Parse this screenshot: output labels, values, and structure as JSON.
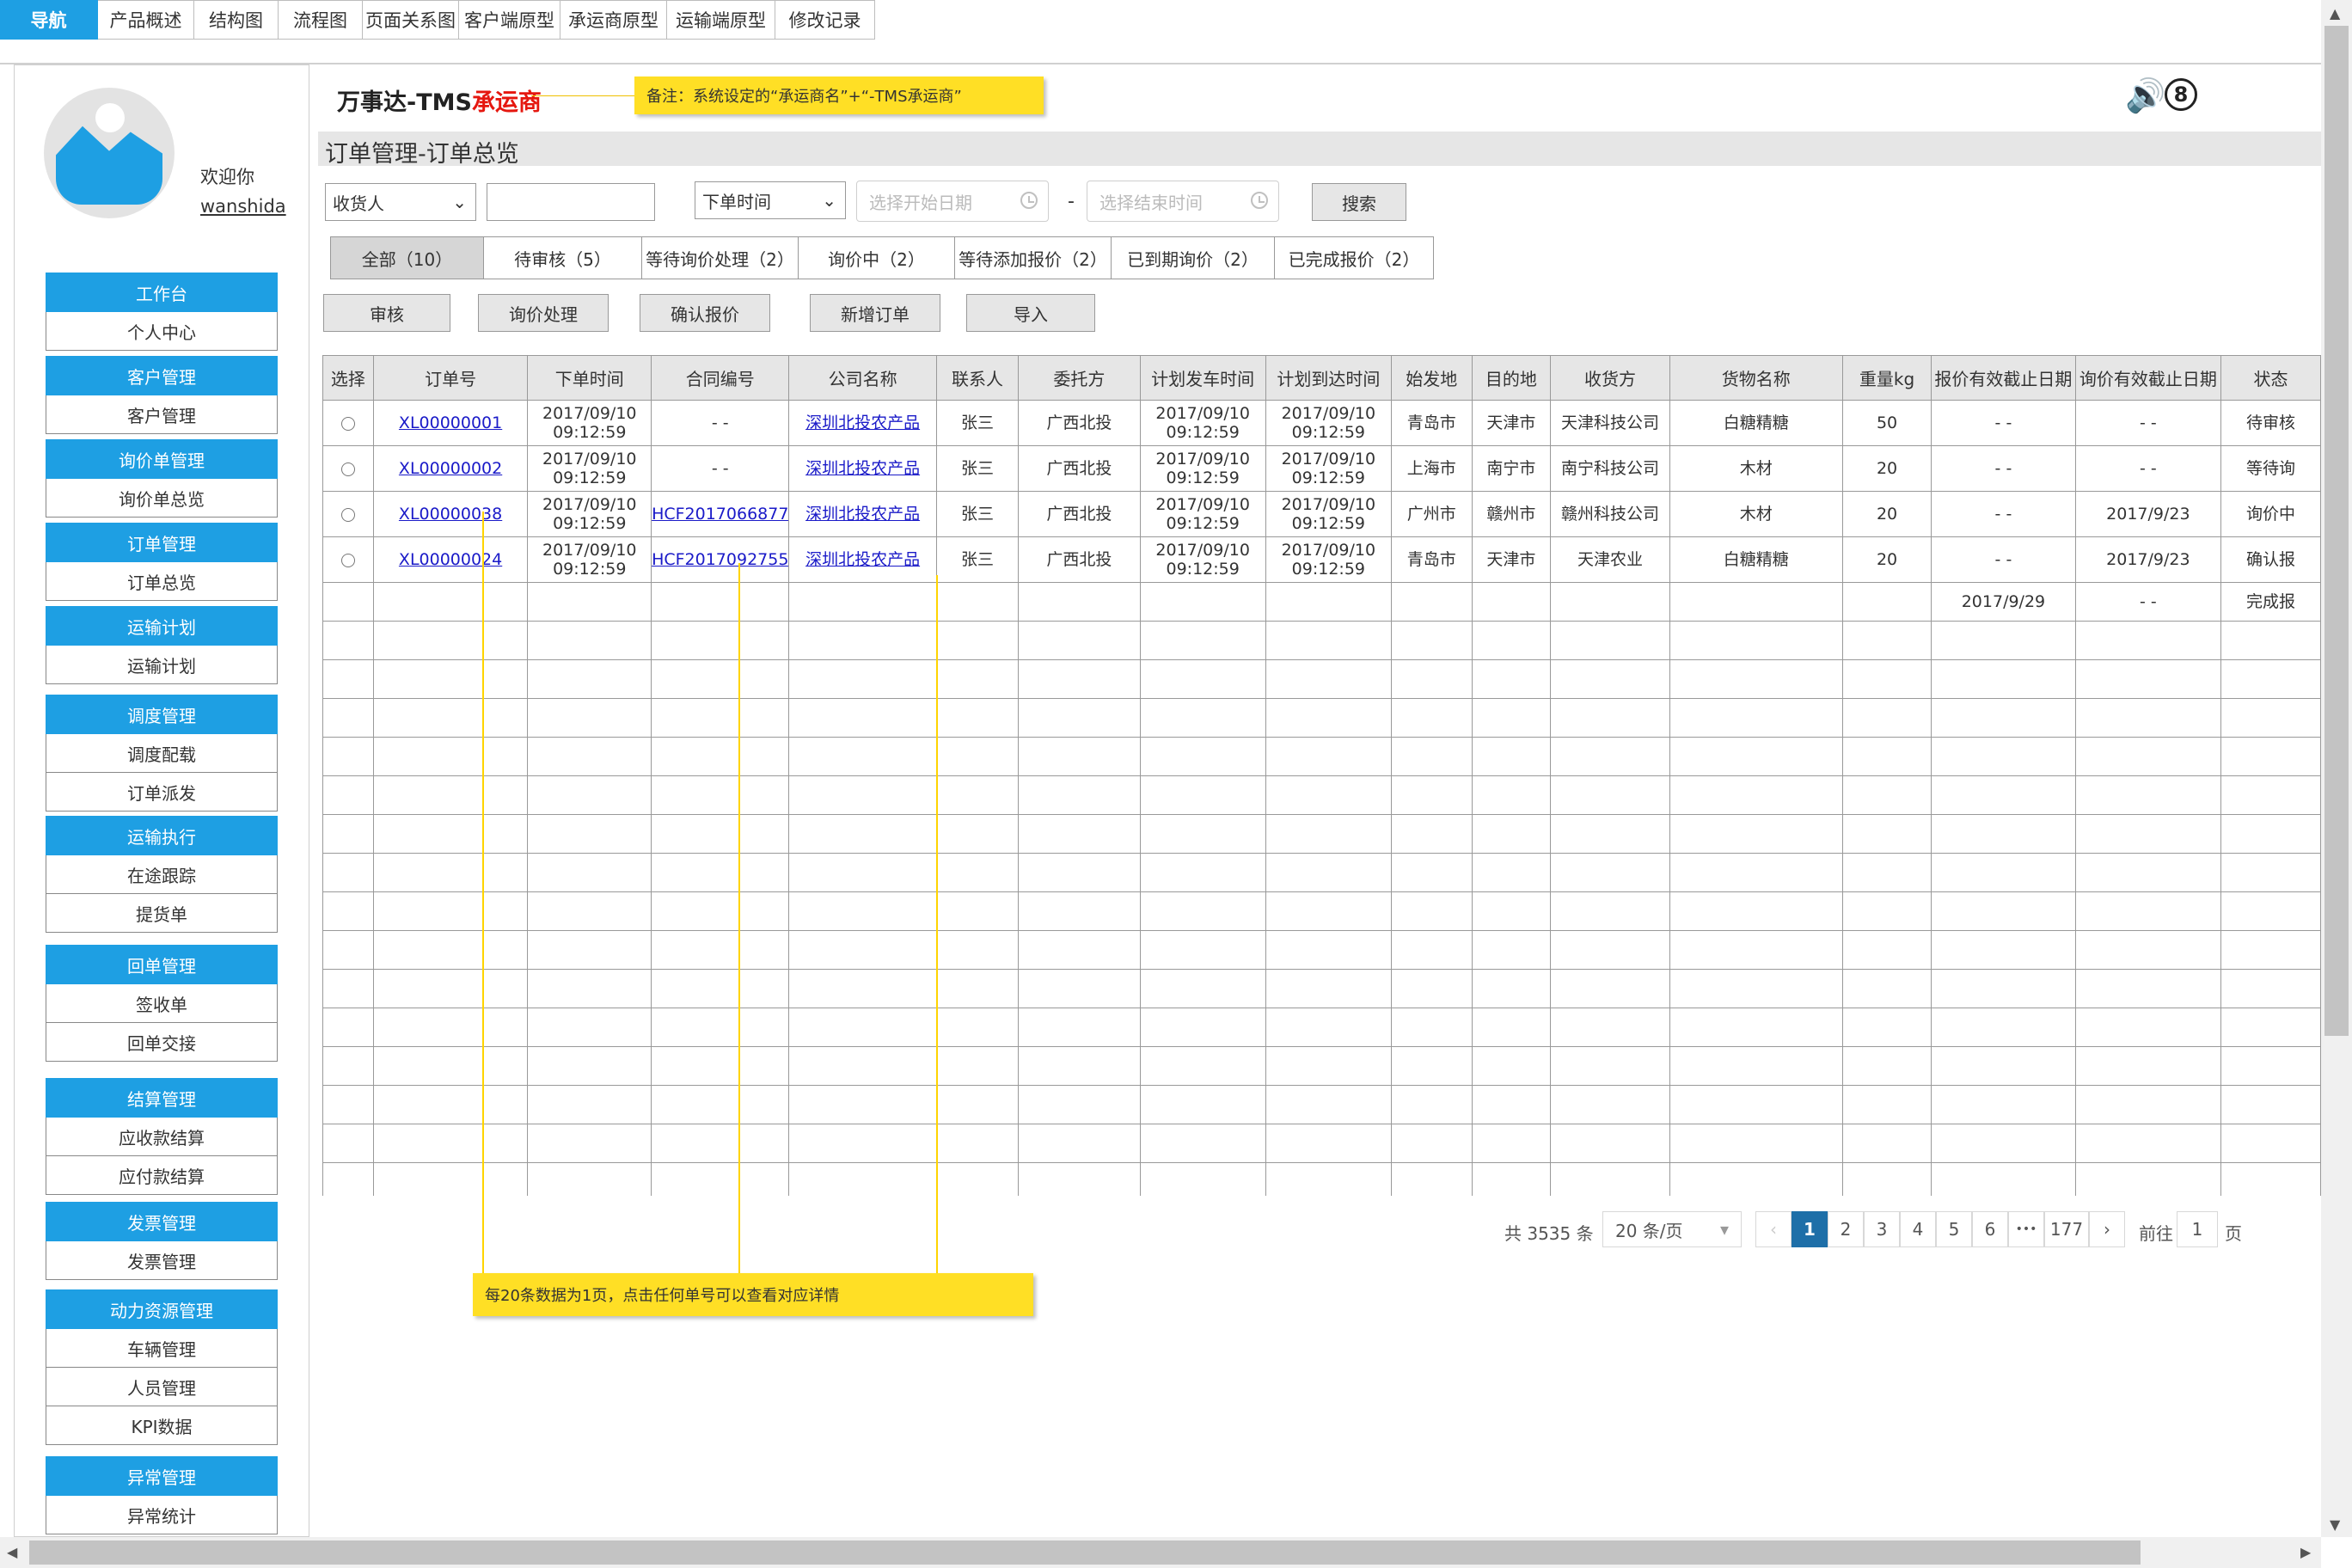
{
  "nav": {
    "tabs": [
      {
        "label": "导航",
        "active": true
      },
      {
        "label": "产品概述"
      },
      {
        "label": "结构图"
      },
      {
        "label": "流程图"
      },
      {
        "label": "页面关系图"
      },
      {
        "label": "客户端原型"
      },
      {
        "label": "承运商原型"
      },
      {
        "label": "运输端原型"
      },
      {
        "label": "修改记录"
      }
    ]
  },
  "user": {
    "welcome": "欢迎你",
    "name": "wanshida"
  },
  "sidebar": {
    "groups": [
      {
        "head": "工作台",
        "items": [
          "个人中心"
        ]
      },
      {
        "head": "客户管理",
        "items": [
          "客户管理"
        ]
      },
      {
        "head": "询价单管理",
        "items": [
          "询价单总览"
        ]
      },
      {
        "head": "订单管理",
        "items": [
          "订单总览"
        ]
      },
      {
        "head": "运输计划",
        "items": [
          "运输计划"
        ]
      },
      {
        "head": "调度管理",
        "items": [
          "调度配载",
          "订单派发"
        ]
      },
      {
        "head": "运输执行",
        "items": [
          "在途跟踪",
          "提货单"
        ]
      },
      {
        "head": "回单管理",
        "items": [
          "签收单",
          "回单交接"
        ]
      },
      {
        "head": "结算管理",
        "items": [
          "应收款结算",
          "应付款结算"
        ]
      },
      {
        "head": "发票管理",
        "items": [
          "发票管理"
        ]
      },
      {
        "head": "动力资源管理",
        "items": [
          "车辆管理",
          "人员管理",
          "KPI数据"
        ]
      },
      {
        "head": "异常管理",
        "items": [
          "异常统计"
        ]
      }
    ]
  },
  "header": {
    "brand_main": "万事达-TMS",
    "brand_red": "承运商",
    "note": "备注：系统设定的“承运商名”+“-TMS承运商”",
    "badge": "8"
  },
  "page": {
    "title": "订单管理-订单总览"
  },
  "filters": {
    "field_select": "收货人",
    "time_select": "下单时间",
    "start_placeholder": "选择开始日期",
    "end_placeholder": "选择结束时间",
    "dash": "-",
    "search": "搜索"
  },
  "status_tabs": [
    {
      "label": "全部（10）",
      "active": true
    },
    {
      "label": "待审核（5）"
    },
    {
      "label": "等待询价处理（2）"
    },
    {
      "label": "询价中（2）"
    },
    {
      "label": "等待添加报价（2）"
    },
    {
      "label": "已到期询价（2）"
    },
    {
      "label": "已完成报价（2）"
    }
  ],
  "actions": [
    "审核",
    "询价处理",
    "确认报价",
    "新增订单",
    "导入"
  ],
  "table": {
    "headers": [
      "选择",
      "订单号",
      "下单时间",
      "合同编号",
      "公司名称",
      "联系人",
      "委托方",
      "计划发车时间",
      "计划到达时间",
      "始发地",
      "目的地",
      "收货方",
      "货物名称",
      "重量kg",
      "报价有效截止日期",
      "询价有效截止日期",
      "状态"
    ],
    "rows": [
      {
        "order": "XL00000001",
        "time_d": "2017/09/10",
        "time_t": "09:12:59",
        "contract": "- -",
        "company": "深圳北投农产品",
        "contact": "张三",
        "client": "广西北投",
        "dep_d": "2017/09/10",
        "dep_t": "09:12:59",
        "arr_d": "2017/09/10",
        "arr_t": "09:12:59",
        "origin": "青岛市",
        "dest": "天津市",
        "receiver": "天津科技公司",
        "goods": "白糖精糖",
        "weight": "50",
        "quote_exp": "- -",
        "inquiry_exp": "- -",
        "status": "待审核"
      },
      {
        "order": "XL00000002",
        "time_d": "2017/09/10",
        "time_t": "09:12:59",
        "contract": "- -",
        "company": "深圳北投农产品",
        "contact": "张三",
        "client": "广西北投",
        "dep_d": "2017/09/10",
        "dep_t": "09:12:59",
        "arr_d": "2017/09/10",
        "arr_t": "09:12:59",
        "origin": "上海市",
        "dest": "南宁市",
        "receiver": "南宁科技公司",
        "goods": "木材",
        "weight": "20",
        "quote_exp": "- -",
        "inquiry_exp": "- -",
        "status": "等待询"
      },
      {
        "order": "XL00000038",
        "time_d": "2017/09/10",
        "time_t": "09:12:59",
        "contract": "HCF2017066877",
        "company": "深圳北投农产品",
        "contact": "张三",
        "client": "广西北投",
        "dep_d": "2017/09/10",
        "dep_t": "09:12:59",
        "arr_d": "2017/09/10",
        "arr_t": "09:12:59",
        "origin": "广州市",
        "dest": "赣州市",
        "receiver": "赣州科技公司",
        "goods": "木材",
        "weight": "20",
        "quote_exp": "- -",
        "inquiry_exp": "2017/9/23",
        "status": "询价中"
      },
      {
        "order": "XL00000024",
        "time_d": "2017/09/10",
        "time_t": "09:12:59",
        "contract": "HCF2017092755",
        "company": "深圳北投农产品",
        "contact": "张三",
        "client": "广西北投",
        "dep_d": "2017/09/10",
        "dep_t": "09:12:59",
        "arr_d": "2017/09/10",
        "arr_t": "09:12:59",
        "origin": "青岛市",
        "dest": "天津市",
        "receiver": "天津农业",
        "goods": "白糖精糖",
        "weight": "20",
        "quote_exp": "- -",
        "inquiry_exp": "2017/9/23",
        "status": "确认报"
      }
    ],
    "extra_row": {
      "quote_exp": "2017/9/29",
      "inquiry_exp": "- -",
      "status": "完成报"
    }
  },
  "table_note": "每20条数据为1页，点击任何单号可以查看对应详情",
  "pagination": {
    "total": "共 3535 条",
    "per_page": "20 条/页",
    "prev": "‹",
    "pages": [
      "1",
      "2",
      "3",
      "4",
      "5",
      "6"
    ],
    "ellipsis": "•••",
    "last": "177",
    "next": "›",
    "goto_label": "前往",
    "goto_value": "1",
    "goto_suffix": "页"
  }
}
